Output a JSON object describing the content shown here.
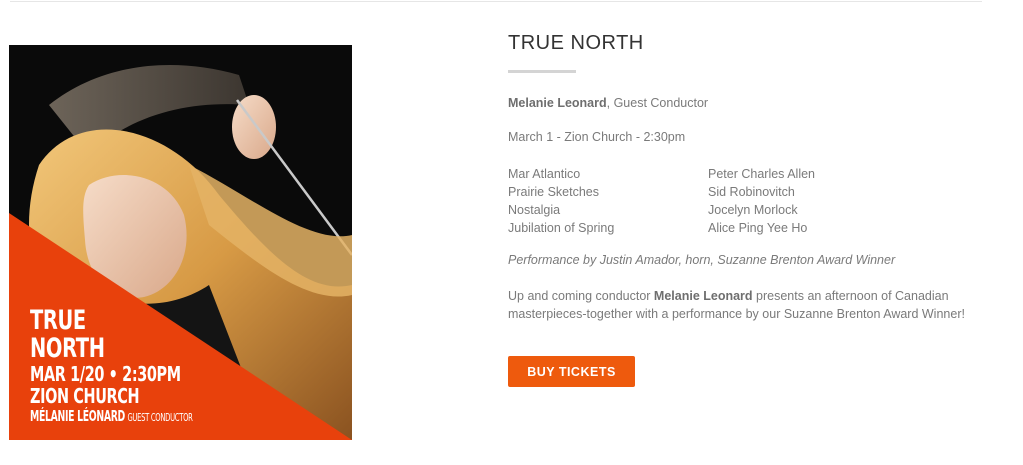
{
  "poster": {
    "title_line1": "TRUE",
    "title_line2": "NORTH",
    "date_time": "MAR 1/20 • 2:30PM",
    "venue": "ZION CHURCH",
    "conductor_name": "MÉLANIE LÉONARD",
    "conductor_role": "GUEST CONDUCTOR",
    "accent_color": "#e8410c"
  },
  "event": {
    "title": "TRUE NORTH",
    "conductor_name": "Melanie Leonard",
    "conductor_role": ", Guest Conductor",
    "date_line": "March 1 - Zion Church - 2:30pm",
    "program": [
      {
        "piece": "Mar Atlantico",
        "composer": "Peter Charles Allen"
      },
      {
        "piece": "Prairie Sketches",
        "composer": "Sid Robinovitch"
      },
      {
        "piece": "Nostalgia",
        "composer": "Jocelyn Morlock"
      },
      {
        "piece": "Jubilation of Spring",
        "composer": "Alice Ping Yee Ho"
      }
    ],
    "performance": "Performance by Justin Amador, horn, Suzanne Brenton Award Winner",
    "description_before": "Up and coming conductor ",
    "description_bold": "Melanie Leonard",
    "description_after": " presents an afternoon of Canadian masterpieces-together with a performance by our Suzanne Brenton Award Winner!",
    "button_label": "BUY TICKETS",
    "button_color": "#ee5a0d"
  }
}
